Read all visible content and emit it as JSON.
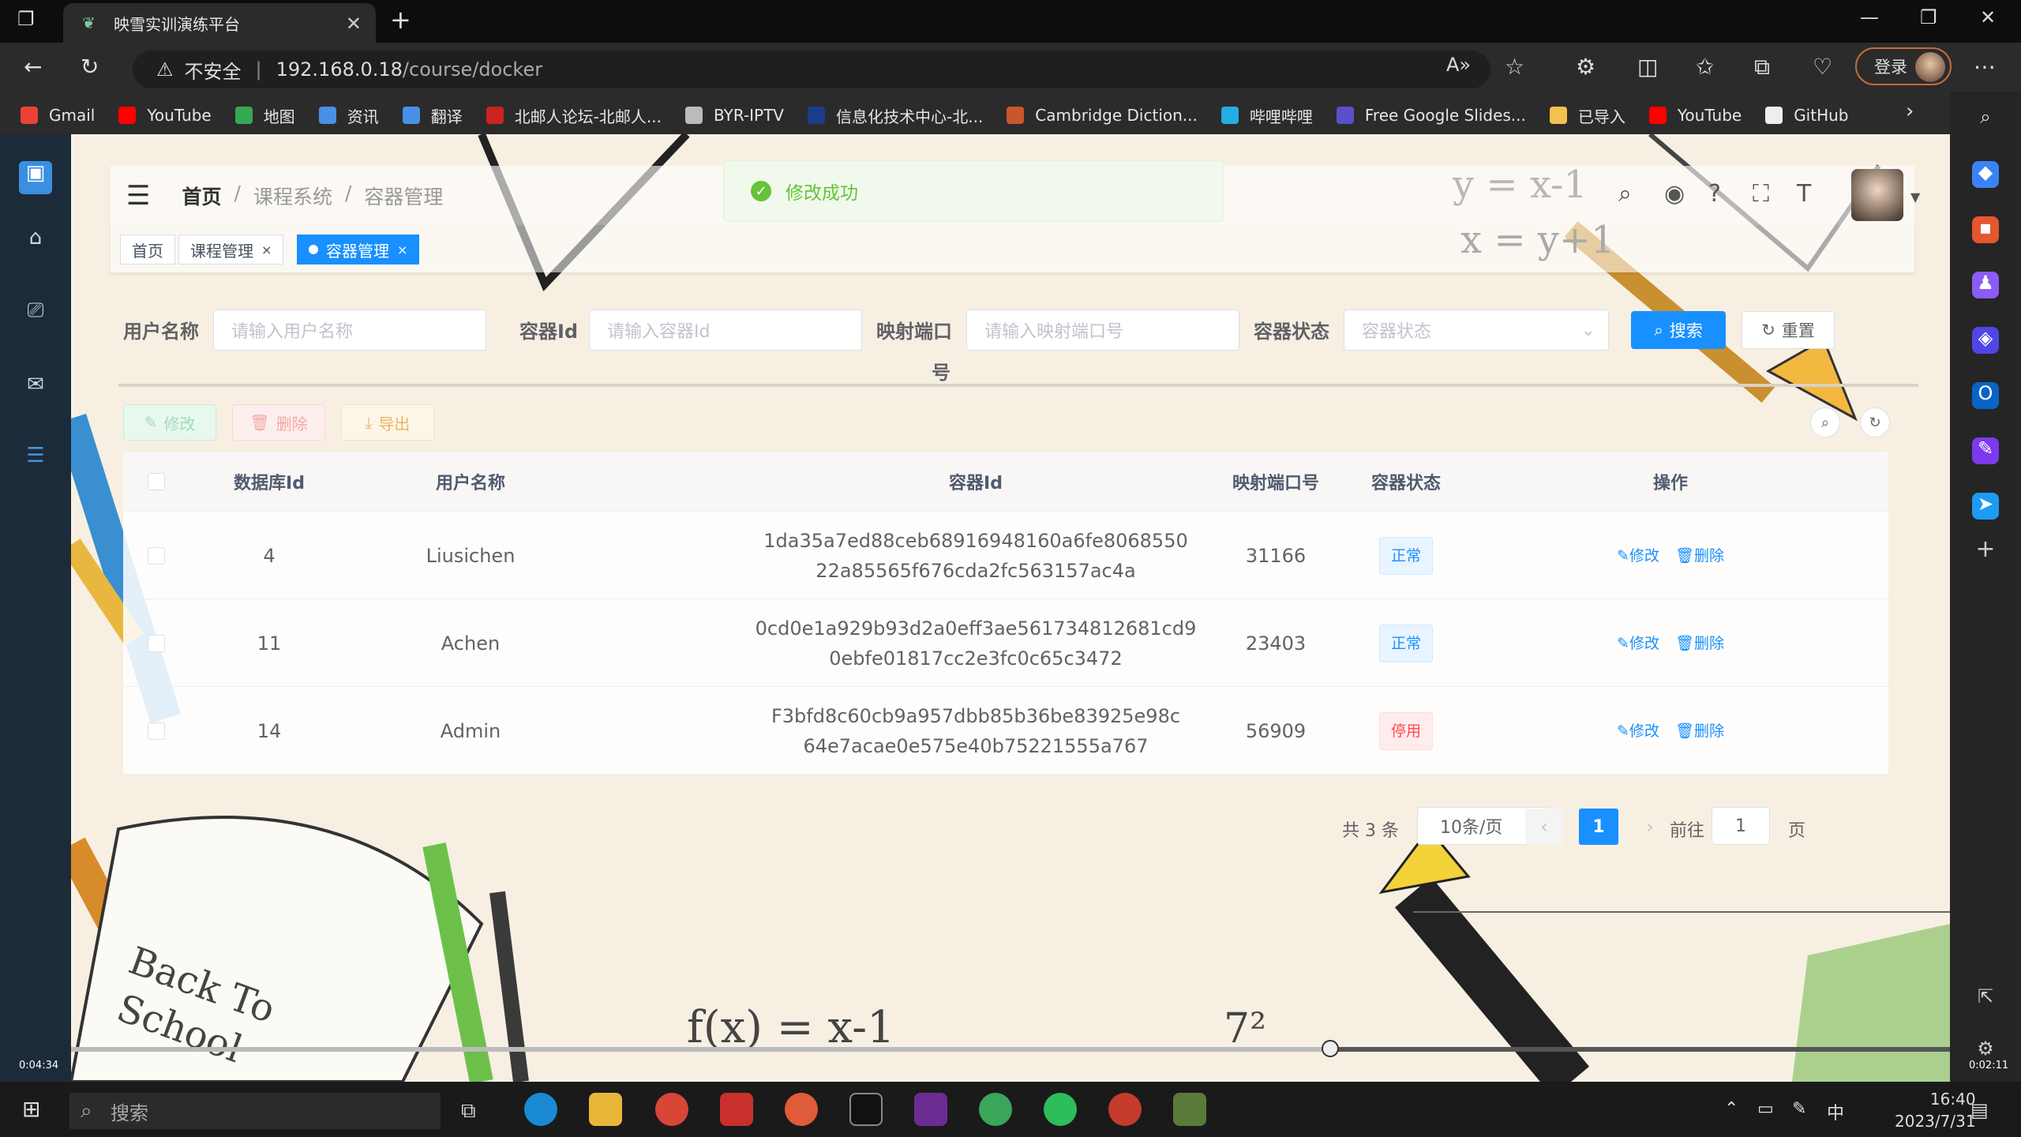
{
  "browser": {
    "tab_title": "映雪实训演练平台",
    "new_tab": "+",
    "close": "✕",
    "insecure_label": "不安全",
    "url_host": "192.168.0.18",
    "url_path": "/course/docker",
    "login_label": "登录"
  },
  "bookmarks": [
    {
      "label": "Gmail",
      "color": "#ea4335"
    },
    {
      "label": "YouTube",
      "color": "#ff0000"
    },
    {
      "label": "地图",
      "color": "#34a853"
    },
    {
      "label": "资讯",
      "color": "#4a8fe7"
    },
    {
      "label": "翻译",
      "color": "#4a8fe7"
    },
    {
      "label": "北邮人论坛-北邮人...",
      "color": "#cc2222"
    },
    {
      "label": "BYR-IPTV",
      "color": "#bbbbbb"
    },
    {
      "label": "信息化技术中心-北...",
      "color": "#1a3c8c"
    },
    {
      "label": "Cambridge Diction...",
      "color": "#c8562a"
    },
    {
      "label": "哔哩哔哩",
      "color": "#23ade5"
    },
    {
      "label": "Free Google Slides...",
      "color": "#5b4fc8"
    },
    {
      "label": "已导入",
      "color": "#f2c14e"
    },
    {
      "label": "YouTube",
      "color": "#ff0000"
    },
    {
      "label": "GitHub",
      "color": "#eeeeee"
    }
  ],
  "header": {
    "breadcrumb": [
      "首页",
      "/",
      "课程系统",
      "/",
      "容器管理"
    ]
  },
  "toast": {
    "message": "修改成功"
  },
  "tags": [
    {
      "label": "首页"
    },
    {
      "label": "课程管理",
      "close": "×"
    },
    {
      "label": "容器管理",
      "close": "×"
    }
  ],
  "search": {
    "user_label": "用户名称",
    "user_placeholder": "请输入用户名称",
    "container_label": "容器Id",
    "container_placeholder": "请输入容器Id",
    "port_label": "映射端口",
    "port_label_wrap": "号",
    "port_placeholder": "请输入映射端口号",
    "status_label": "容器状态",
    "status_placeholder": "容器状态",
    "search_btn": "搜索",
    "reset_btn": "重置"
  },
  "toolbar": {
    "edit": "修改",
    "delete": "删除",
    "export": "导出"
  },
  "table": {
    "columns": [
      "数据库Id",
      "用户名称",
      "容器Id",
      "映射端口号",
      "容器状态",
      "操作"
    ],
    "rows": [
      {
        "db_id": "4",
        "user": "Liusichen",
        "cid1": "1da35a7ed88ceb68916948160a6fe8068550",
        "cid2": "22a85565f676cda2fc563157ac4a",
        "port": "31166",
        "status": "正常",
        "status_type": "ok",
        "edit": "修改",
        "del": "删除"
      },
      {
        "db_id": "11",
        "user": "Achen",
        "cid1": "0cd0e1a929b93d2a0eff3ae561734812681cd9",
        "cid2": "0ebfe01817cc2e3fc0c65c3472",
        "port": "23403",
        "status": "正常",
        "status_type": "ok",
        "edit": "修改",
        "del": "删除"
      },
      {
        "db_id": "14",
        "user": "Admin",
        "cid1": "F3bfd8c60cb9a957dbb85b36be83925e98c",
        "cid2": "64e7acae0e575e40b75221555a767",
        "port": "56909",
        "status": "停用",
        "status_type": "stop",
        "edit": "修改",
        "del": "删除"
      }
    ]
  },
  "pagination": {
    "total": "共 3 条",
    "page_size": "10条/页",
    "current": "1",
    "goto_label": "前往",
    "goto_value": "1",
    "goto_unit": "页"
  },
  "video": {
    "elapsed": "0:04:34",
    "total": "0:02:11",
    "progress": 0.67
  },
  "taskbar": {
    "search": "搜索",
    "time": "16:40",
    "date": "2023/7/31",
    "ime": "中"
  },
  "colors": {
    "primary": "#1890ff",
    "success": "#67c23a",
    "danger": "#ff4949"
  }
}
